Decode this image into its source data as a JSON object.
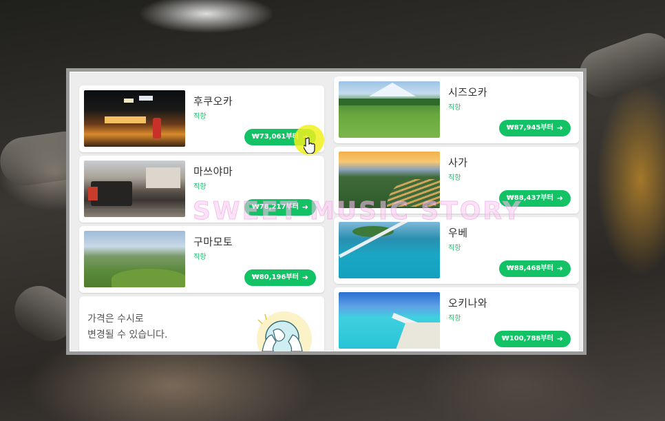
{
  "left_column": [
    {
      "name": "후쿠오카",
      "sub": "직항",
      "price": "₩73,061부터",
      "image": "night-street-market"
    },
    {
      "name": "마쓰야마",
      "sub": "직항",
      "price": "₩78,217부터",
      "image": "steam-train-station"
    },
    {
      "name": "구마모토",
      "sub": "직항",
      "price": "₩80,196부터",
      "image": "green-hills-landscape"
    }
  ],
  "right_column": [
    {
      "name": "시즈오카",
      "sub": "직항",
      "price": "₩87,945부터",
      "image": "mount-fuji-tea-fields"
    },
    {
      "name": "사가",
      "sub": "직항",
      "price": "₩88,437부터",
      "image": "terraced-rice-fields-sunset"
    },
    {
      "name": "우베",
      "sub": "직항",
      "price": "₩88,468부터",
      "image": "bridge-over-blue-sea"
    },
    {
      "name": "오키나와",
      "sub": "직항",
      "price": "₩100,788부터",
      "image": "long-bridge-turquoise-sea"
    }
  ],
  "info": {
    "line1": "가격은 수시로",
    "line2": "변경될 수 있습니다.",
    "icon": "globe-hands-icon"
  },
  "watermark": "SWEET MUSIC STORY",
  "colors": {
    "accent": "#12c265",
    "sub_text": "#1fbf6a",
    "highlight": "#f0f01e"
  }
}
